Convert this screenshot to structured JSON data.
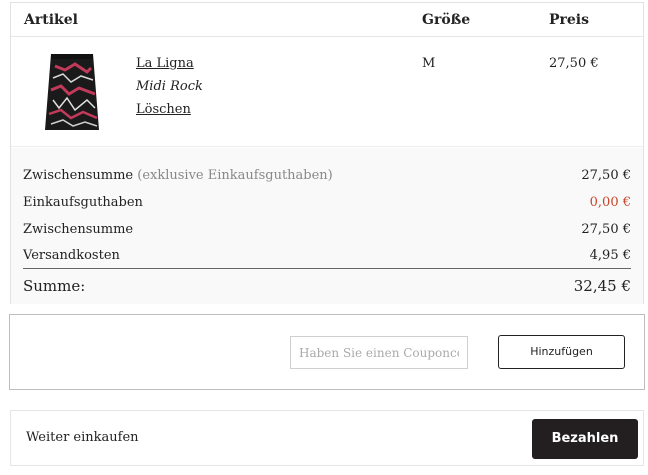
{
  "cart": {
    "headers": {
      "artikel": "Artikel",
      "groesse": "Größe",
      "preis": "Preis"
    },
    "items": [
      {
        "brand": "La Ligna",
        "name": "Midi Rock",
        "remove_label": "Löschen",
        "size": "M",
        "price": "27,50 €"
      }
    ]
  },
  "summary": {
    "subtotal_excl": {
      "label": "Zwischensumme",
      "note": " (exklusive Einkaufsguthaben)",
      "value": "27,50 €"
    },
    "credit": {
      "label": "Einkaufsguthaben",
      "value": "0,00 €"
    },
    "subtotal": {
      "label": "Zwischensumme",
      "value": "27,50 €"
    },
    "shipping": {
      "label": "Versandkosten",
      "value": "4,95 €"
    },
    "total": {
      "label": "Summe:",
      "value": "32,45 €"
    }
  },
  "coupon": {
    "placeholder": "Haben Sie einen Couponcode?",
    "button_label": "Hinzufügen"
  },
  "actions": {
    "continue_label": "Weiter einkaufen",
    "pay_label": "Bezahlen"
  },
  "colors": {
    "credit_value": "#c8462b",
    "pay_button": "#231f20"
  }
}
